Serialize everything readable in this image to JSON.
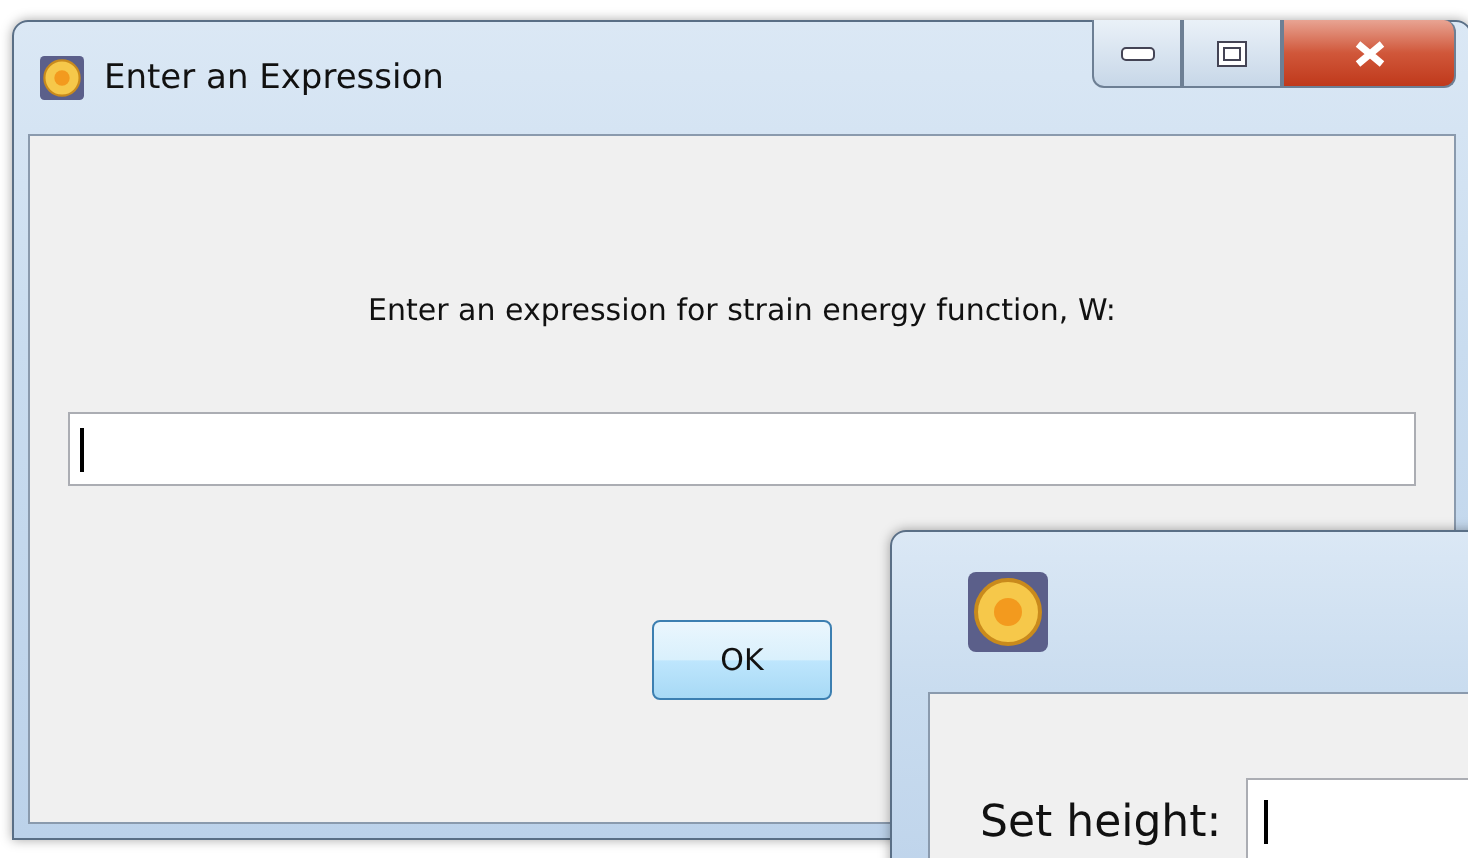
{
  "window": {
    "title": "Enter an Expression"
  },
  "prompt": "Enter an expression for strain energy function, W:",
  "buttons": [
    "OK"
  ],
  "second_window": {
    "field_label": "Set height:"
  }
}
